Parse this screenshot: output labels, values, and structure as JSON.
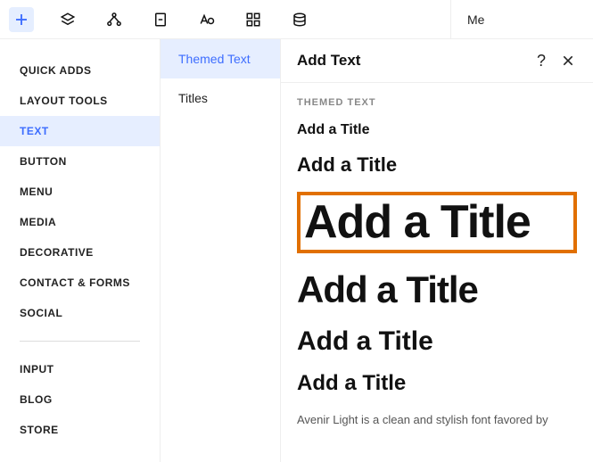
{
  "topbar": {
    "icons": [
      "plus-icon",
      "layers-icon",
      "nodes-icon",
      "page-icon",
      "typography-icon",
      "grid-icon",
      "data-icon"
    ],
    "me_label": "Me"
  },
  "sidebar": {
    "items": [
      {
        "label": "QUICK ADDS"
      },
      {
        "label": "LAYOUT TOOLS"
      },
      {
        "label": "TEXT",
        "selected": true
      },
      {
        "label": "BUTTON"
      },
      {
        "label": "MENU"
      },
      {
        "label": "MEDIA"
      },
      {
        "label": "DECORATIVE"
      },
      {
        "label": "CONTACT & FORMS"
      },
      {
        "label": "SOCIAL"
      }
    ],
    "items2": [
      {
        "label": "INPUT"
      },
      {
        "label": "BLOG"
      },
      {
        "label": "STORE"
      }
    ]
  },
  "subpanel": {
    "items": [
      {
        "label": "Themed Text",
        "selected": true
      },
      {
        "label": "Titles"
      }
    ]
  },
  "content": {
    "header": {
      "title": "Add Text",
      "help": "?",
      "close": "×"
    },
    "section_label": "THEMED TEXT",
    "titles": [
      "Add a Title",
      "Add a Title",
      "Add a Title",
      "Add a Title",
      "Add a Title",
      "Add a Title"
    ],
    "body_text": "Avenir Light is a clean and stylish font favored by"
  }
}
